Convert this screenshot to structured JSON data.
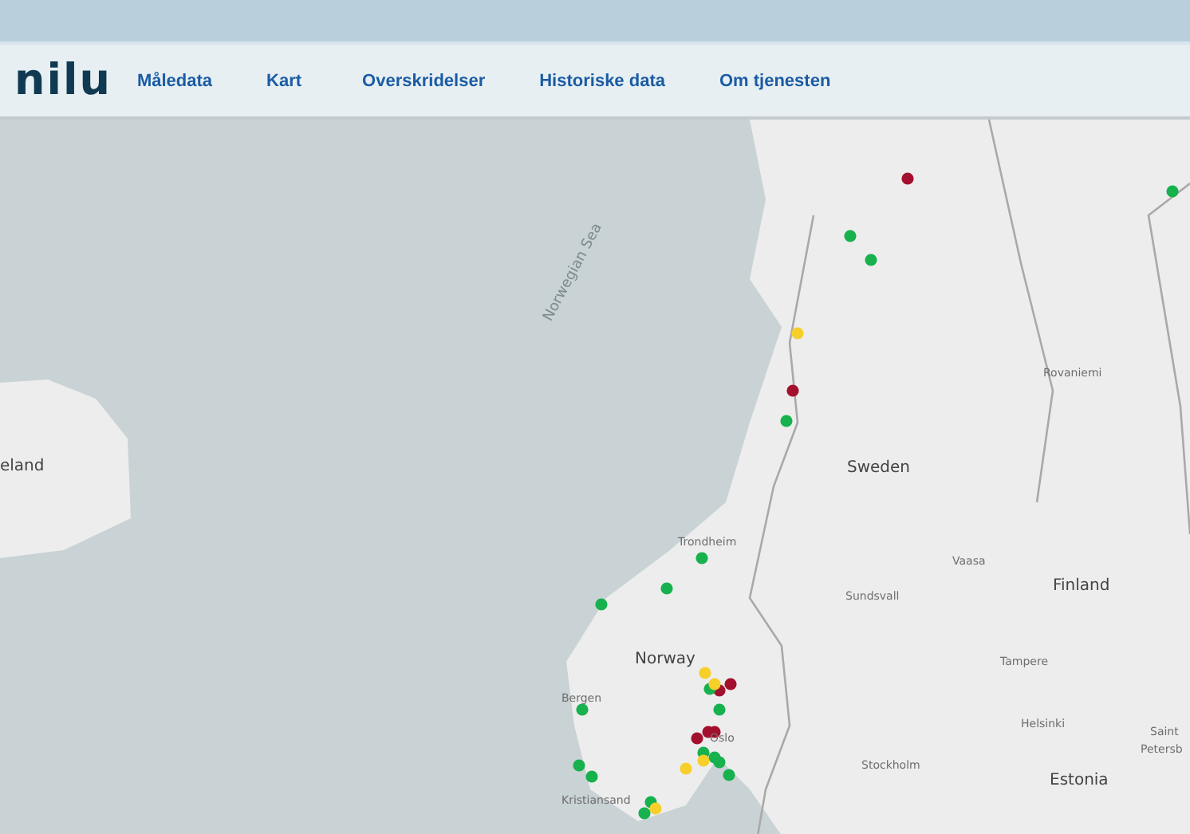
{
  "header": {
    "logo": "nilu",
    "nav": [
      {
        "label": "Måledata"
      },
      {
        "label": "Kart"
      },
      {
        "label": "Overskridelser"
      },
      {
        "label": "Historiske data"
      },
      {
        "label": "Om tjenesten"
      }
    ]
  },
  "map": {
    "labels": [
      {
        "text": "Norwegian Sea",
        "kind": "sea"
      },
      {
        "text": "Rovaniemi",
        "kind": "city"
      },
      {
        "text": "eland",
        "kind": "country"
      },
      {
        "text": "Sweden",
        "kind": "country"
      },
      {
        "text": "Trondheim",
        "kind": "city"
      },
      {
        "text": "Vaasa",
        "kind": "city"
      },
      {
        "text": "Finland",
        "kind": "country"
      },
      {
        "text": "Sundsvall",
        "kind": "city"
      },
      {
        "text": "Norway",
        "kind": "country"
      },
      {
        "text": "Tampere",
        "kind": "city"
      },
      {
        "text": "Bergen",
        "kind": "city"
      },
      {
        "text": "Helsinki",
        "kind": "city"
      },
      {
        "text": "Saint",
        "kind": "city"
      },
      {
        "text": "Oslo",
        "kind": "city"
      },
      {
        "text": "Petersb",
        "kind": "city"
      },
      {
        "text": "Stockholm",
        "kind": "city"
      },
      {
        "text": "Estonia",
        "kind": "country"
      },
      {
        "text": "Kristiansand",
        "kind": "city"
      }
    ],
    "stations": [
      {
        "color": "#a3102e"
      },
      {
        "color": "#a3102e"
      },
      {
        "color": "#a3102e"
      },
      {
        "color": "#a3102e"
      },
      {
        "color": "#a3102e"
      },
      {
        "color": "#a3102e"
      },
      {
        "color": "#a3102e"
      },
      {
        "color": "#17b14e"
      },
      {
        "color": "#17b14e"
      },
      {
        "color": "#17b14e"
      },
      {
        "color": "#17b14e"
      },
      {
        "color": "#17b14e"
      },
      {
        "color": "#17b14e"
      },
      {
        "color": "#17b14e"
      },
      {
        "color": "#17b14e"
      },
      {
        "color": "#17b14e"
      },
      {
        "color": "#17b14e"
      },
      {
        "color": "#17b14e"
      },
      {
        "color": "#17b14e"
      },
      {
        "color": "#17b14e"
      },
      {
        "color": "#17b14e"
      },
      {
        "color": "#17b14e"
      },
      {
        "color": "#17b14e"
      },
      {
        "color": "#17b14e"
      },
      {
        "color": "#17b14e"
      },
      {
        "color": "#f7cf2a"
      },
      {
        "color": "#f7cf2a"
      },
      {
        "color": "#f7cf2a"
      },
      {
        "color": "#f7cf2a"
      },
      {
        "color": "#f7cf2a"
      },
      {
        "color": "#f7cf2a"
      }
    ]
  }
}
